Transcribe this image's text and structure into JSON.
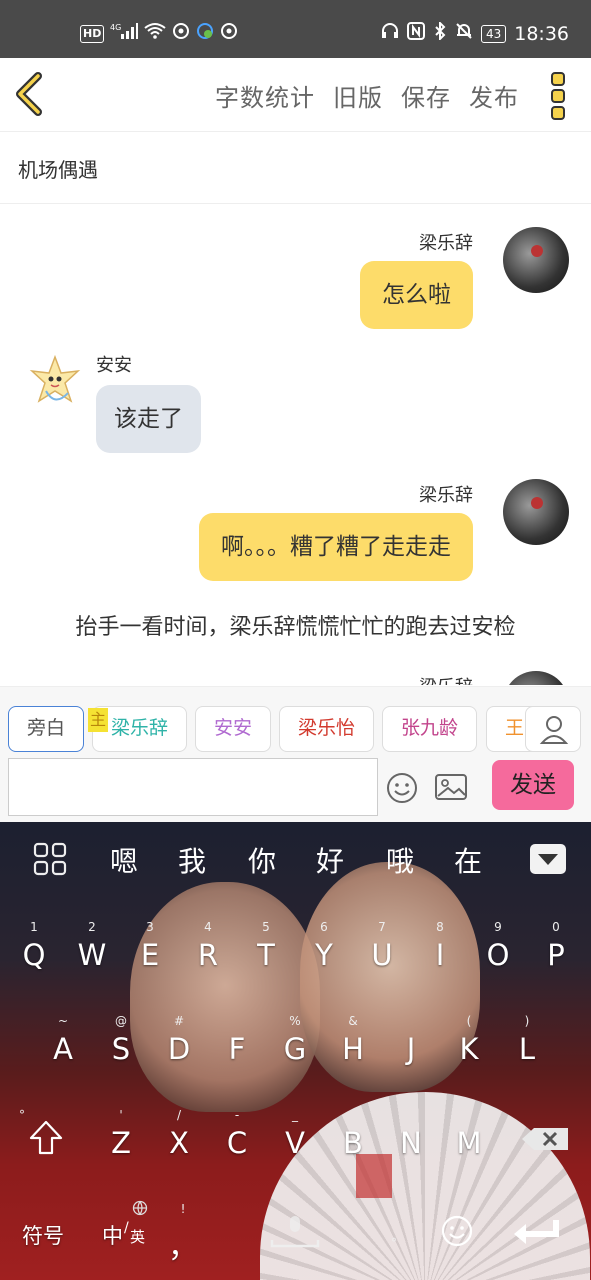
{
  "status_bar": {
    "left_icons": [
      "hd-icon",
      "signal-4g-icon",
      "wifi-icon",
      "sync-icon",
      "vpn-icon",
      "sync-icon"
    ],
    "hd_label": "HD",
    "network_label": "4G",
    "battery": "43",
    "time": "18:36",
    "right_icons": [
      "headphone-icon",
      "nfc-icon",
      "bluetooth-icon",
      "mute-icon",
      "battery-icon"
    ]
  },
  "toolbar": {
    "back_icon": "chevron-left-icon",
    "actions": [
      "字数统计",
      "旧版",
      "保存",
      "发布"
    ],
    "more_icon": "more-dots-icon"
  },
  "doc": {
    "title": "机场偶遇"
  },
  "chat": {
    "messages": [
      {
        "side": "right",
        "speaker": "梁乐辞",
        "text": "怎么啦"
      },
      {
        "side": "left",
        "speaker": "安安",
        "text": "该走了"
      },
      {
        "side": "right",
        "speaker": "梁乐辞",
        "text": "啊。。。糟了糟了走走走"
      },
      {
        "side": "narration",
        "text": "抬手一看时间，梁乐辞慌慌忙忙的跑去过安检"
      },
      {
        "side": "right",
        "speaker": "梁乐辞",
        "text": ""
      }
    ]
  },
  "roles": {
    "items": [
      {
        "label": "旁白",
        "color": "#555555",
        "selected": true
      },
      {
        "label": "梁乐辞",
        "color": "#2fb3a8",
        "selected": false
      },
      {
        "label": "安安",
        "color": "#b06ad0",
        "selected": false
      },
      {
        "label": "梁乐怡",
        "color": "#d23a2e",
        "selected": false
      },
      {
        "label": "张九龄",
        "color": "#c2448c",
        "selected": false
      },
      {
        "label": "王",
        "color": "#f0922e",
        "selected": false
      }
    ],
    "main_mark": "主",
    "person_icon": "person-icon"
  },
  "composer": {
    "input_value": "",
    "emoji_icon": "emoji-icon",
    "image_icon": "image-icon",
    "send_label": "发送"
  },
  "keyboard": {
    "candidates": [
      "嗯",
      "我",
      "你",
      "好",
      "哦",
      "在"
    ],
    "row1": [
      "Q",
      "W",
      "E",
      "R",
      "T",
      "Y",
      "U",
      "I",
      "O",
      "P"
    ],
    "row1_sub": [
      "1",
      "2",
      "3",
      "4",
      "5",
      "6",
      "7",
      "8",
      "9",
      "0"
    ],
    "row2": [
      "A",
      "S",
      "D",
      "F",
      "G",
      "H",
      "J",
      "K",
      "L"
    ],
    "row2_sub": [
      "~",
      "@",
      "#",
      "",
      "%",
      "",
      "&",
      "(",
      ")"
    ],
    "row3": [
      "Z",
      "X",
      "C",
      "V",
      "B",
      "N",
      "M"
    ],
    "row3_sub": [
      "'",
      "/",
      "-",
      "_",
      "",
      "",
      ""
    ],
    "shift_sub": "°",
    "symbols_label": "符号",
    "lang_label_a": "中",
    "lang_label_b": "英",
    "comma_label": "，",
    "comma_sub": "!",
    "dot_label": "°"
  }
}
